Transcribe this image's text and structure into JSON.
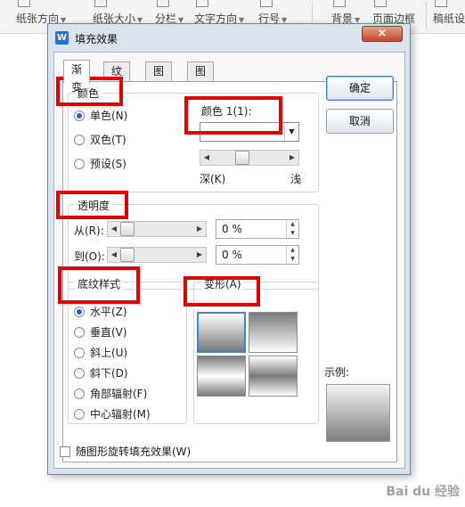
{
  "ribbon": {
    "items": [
      "纸张方向",
      "纸张大小",
      "分栏",
      "文字方向",
      "行号",
      "背景",
      "页面边框",
      "稿纸设"
    ]
  },
  "dialog": {
    "title": "填充效果",
    "close_label": "×",
    "tabs": [
      "渐变",
      "纹理",
      "图案",
      "图片"
    ],
    "active_tab": "渐变",
    "color_group": {
      "title": "颜色",
      "options": [
        "单色(N)",
        "双色(T)",
        "预设(S)"
      ],
      "selected": "单色(N)",
      "color_label": "颜色 1(1):",
      "color_value": "",
      "dark_label": "深(K)",
      "light_label": "浅",
      "shade_level_fraction": 0.38
    },
    "transparency_group": {
      "title": "透明度",
      "from_label": "从(R):",
      "to_label": "到(O):",
      "from_value": "0 %",
      "to_value": "0 %",
      "from_level_fraction": 0.0,
      "to_level_fraction": 0.0
    },
    "shading_group": {
      "title": "底纹样式",
      "options": [
        "水平(Z)",
        "垂直(V)",
        "斜上(U)",
        "斜下(D)",
        "角部辐射(F)",
        "中心辐射(M)"
      ],
      "selected": "水平(Z)"
    },
    "variants_group": {
      "title": "变形(A)",
      "selected_index": 0
    },
    "buttons": {
      "ok": "确定",
      "cancel": "取消"
    },
    "sample_label": "示例:",
    "rotate_checkbox_label": "随图形旋转填充效果(W)",
    "rotate_checked": false
  },
  "colors": {
    "annotation_red": "#e00000",
    "dialog_frame": "#dbe4ee",
    "selection_blue": "#2463c4"
  },
  "watermark": "Bai du 经验"
}
